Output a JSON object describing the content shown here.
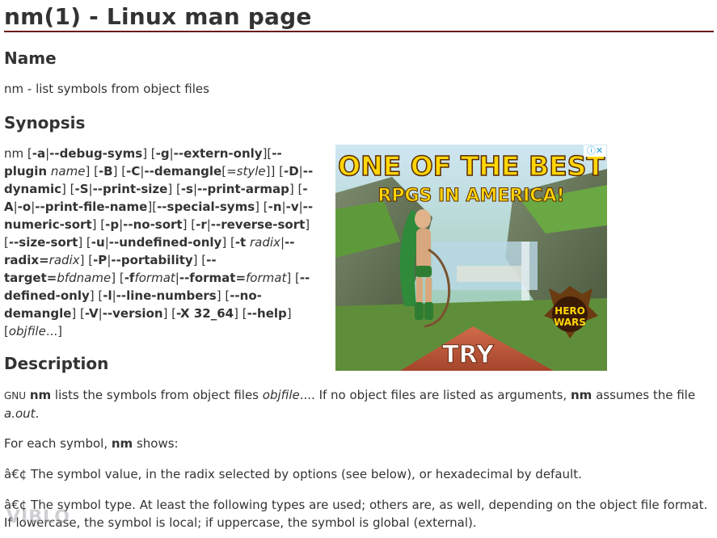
{
  "title": "nm(1) - Linux man page",
  "sections": {
    "name_heading": "Name",
    "name_text": "nm - list symbols from object files",
    "synopsis_heading": "Synopsis",
    "description_heading": "Description"
  },
  "synopsis_html": "nm [<b>-a</b>|<b>--debug-syms</b>] [<b>-g</b>|<b>--extern-only</b>][<b>--plugin</b> <i>name</i>] [<b>-B</b>] [<b>-C</b>|<b>--demangle</b>[=<i>style</i>]] [<b>-D</b>|<b>--dynamic</b>] [<b>-S</b>|<b>--print-size</b>] [<b>-s</b>|<b>--print-armap</b>] [<b>-A</b>|<b>-o</b>|<b>--print-file-name</b>][<b>--special-syms</b>] [<b>-n</b>|<b>-v</b>|<b>--numeric-sort</b>] [<b>-p</b>|<b>--no-sort</b>] [<b>-r</b>|<b>--reverse-sort</b>] [<b>--size-sort</b>] [<b>-u</b>|<b>--undefined-only</b>] [<b>-t</b> <i>radix</i>|<b>--radix=</b><i>radix</i>] [<b>-P</b>|<b>--portability</b>] [<b>--target=</b><i>bfdname</i>] [<b>-f</b><i>format</i>|<b>--format=</b><i>format</i>] [<b>--defined-only</b>] [<b>-l</b>|<b>--line-numbers</b>] [<b>--no-demangle</b>] [<b>-V</b>|<b>--version</b>] [<b>-X 32_64</b>] [<b>--help</b>] [<i>objfile</i>...]",
  "description": {
    "para1_html": "<span class=\"sc\">GNU</span> <b>nm</b> lists the symbols from object files <i>objfile</i>.... If no object files are listed as arguments, <b>nm</b> assumes the file <i>a.out</i>.",
    "para2_html": "For each symbol, <b>nm</b> shows:",
    "para3": "â€¢ The symbol value, in the radix selected by options (see below), or hexadecimal by default.",
    "para4": "â€¢ The symbol type. At least the following types are used; others are, as well, depending on the object file format. If lowercase, the symbol is local; if uppercase, the symbol is global (external)."
  },
  "ad": {
    "headline1": "ONE OF THE BEST",
    "headline2": "RPGS IN AMERICA!",
    "cta": "TRY",
    "logo_line1": "HERO",
    "logo_line2": "WARS",
    "choices_icon": "adchoices-icon",
    "close_icon": "close-icon"
  },
  "watermark": "VIBLO"
}
